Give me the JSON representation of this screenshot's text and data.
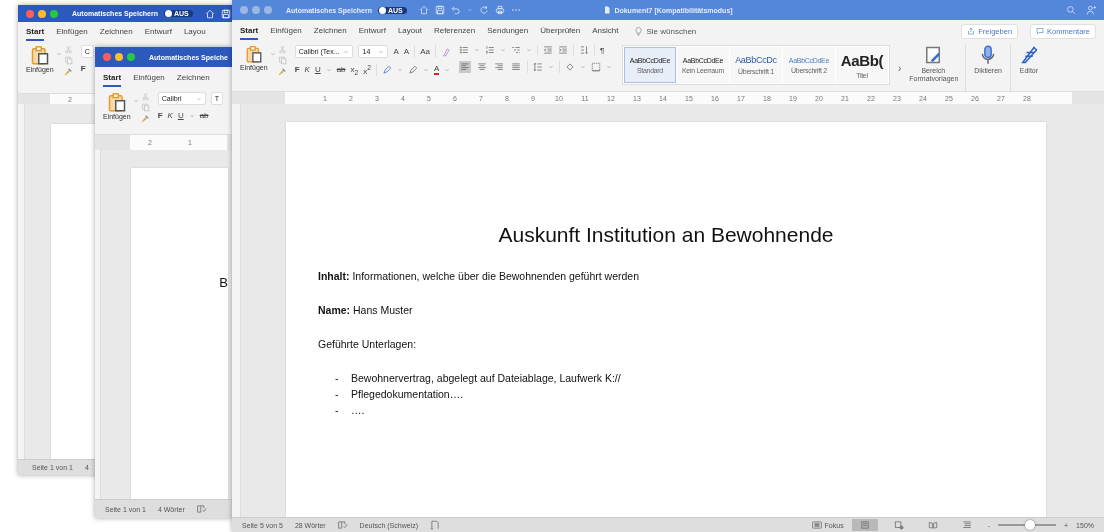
{
  "windows": [
    {
      "focused": true,
      "title_bar": {
        "autosave_label": "Automatisches Speichern",
        "autosave_toggle": {
          "label": "AUS",
          "on": false
        }
      },
      "tabs": [
        {
          "label": "Start",
          "selected": true
        },
        {
          "label": "Einfügen",
          "selected": false
        },
        {
          "label": "Zeichnen",
          "selected": false
        },
        {
          "label": "Entwurf",
          "selected": false
        },
        {
          "label": "Layou",
          "selected": false
        }
      ],
      "ribbon": {
        "paste_label": "Einfügen",
        "font_name": "C",
        "format_buttons": [
          "F"
        ]
      },
      "ruler_labels": [
        "2"
      ],
      "status_bar": {
        "page": "Seite 1 von 1",
        "word_count": "4"
      }
    },
    {
      "focused": true,
      "title_bar": {
        "autosave_label": "Automatisches Speiche"
      },
      "tabs": [
        {
          "label": "Start",
          "selected": true
        },
        {
          "label": "Einfügen",
          "selected": false
        },
        {
          "label": "Zeichnen",
          "selected": false
        }
      ],
      "ribbon": {
        "paste_label": "Einfügen",
        "font_name": "Calibri",
        "cut_control_text": "T",
        "format_buttons": [
          "F",
          "K",
          "U",
          "ab"
        ]
      },
      "ruler_labels": [
        "2",
        "1"
      ],
      "document": {
        "blocks": [
          {
            "kind": "heading",
            "text": "B"
          }
        ]
      },
      "status_bar": {
        "page": "Seite 1 von 1",
        "word_count": "4 Wörter"
      }
    },
    {
      "focused": false,
      "title_bar": {
        "autosave_label": "Automatisches Speichern",
        "autosave_toggle": {
          "label": "AUS",
          "on": false
        },
        "document_title": "Dokument7 [Kompatibilitätsmodus]"
      },
      "tabs": [
        {
          "label": "Start",
          "selected": true
        },
        {
          "label": "Einfügen",
          "selected": false
        },
        {
          "label": "Zeichnen",
          "selected": false
        },
        {
          "label": "Entwurf",
          "selected": false
        },
        {
          "label": "Layout",
          "selected": false
        },
        {
          "label": "Referenzen",
          "selected": false
        },
        {
          "label": "Sendungen",
          "selected": false
        },
        {
          "label": "Überprüfen",
          "selected": false
        },
        {
          "label": "Ansicht",
          "selected": false
        }
      ],
      "tell_me": "Sie wünschen",
      "share_button": "Freigeben",
      "comments_button": "Kommentare",
      "ribbon": {
        "paste_label": "Einfügen",
        "font_name": "Calibri (Tex...",
        "font_size": "14",
        "grow_font_button": "A",
        "shrink_font_button": "A",
        "case_button": "Aa",
        "pilcrow": "¶",
        "font_color_button": "A",
        "more_styles_arrow": "›",
        "format_buttons": [
          "F",
          "K",
          "U",
          "ab",
          "x$_{2}$",
          "x$^{2}$"
        ],
        "alignment": [
          {
            "selected": true
          },
          {
            "selected": false
          },
          {
            "selected": false
          },
          {
            "selected": false
          }
        ],
        "styles": [
          {
            "kind": "normal",
            "preview": "AaBbCcDdEe",
            "name": "Standard",
            "selected": true
          },
          {
            "kind": "normal",
            "preview": "AaBbCcDdEe",
            "name": "Kein Leerraum",
            "selected": false
          },
          {
            "kind": "heading1",
            "preview": "AaBbCcDc",
            "name": "Überschrift 1",
            "selected": false
          },
          {
            "kind": "heading2",
            "preview": "AaBbCcDdEe",
            "name": "Überschrift 2",
            "selected": false
          },
          {
            "kind": "title",
            "preview": "AaBb(",
            "name": "Titel",
            "selected": false
          }
        ],
        "styles_pane_label": "Bereich Formatvorlagen",
        "dictate_label": "Diktieren",
        "editor_label": "Editor"
      },
      "ruler_labels": [
        "1",
        "2",
        "3",
        "4",
        "5",
        "6",
        "7",
        "8",
        "9",
        "10",
        "11",
        "12",
        "13",
        "14",
        "15",
        "16",
        "17",
        "18",
        "19",
        "20",
        "21",
        "22",
        "23",
        "24",
        "25",
        "26",
        "27",
        "28"
      ],
      "document": {
        "blocks": [
          {
            "kind": "heading",
            "text": "Auskunft Institution an Bewohnende"
          },
          {
            "kind": "paragraph",
            "text": "**Inhalt:** Informationen, welche über die Bewohnenden geführt werden"
          },
          {
            "kind": "paragraph",
            "text": "**Name:** Hans Muster"
          },
          {
            "kind": "paragraph",
            "text": "Geführte Unterlagen:"
          },
          {
            "kind": "bullet",
            "marker": "-",
            "text": "Bewohnervertrag, abgelegt auf Dateiablage, Laufwerk K://"
          },
          {
            "kind": "bullet",
            "marker": "-",
            "text": "Pflegedokumentation…."
          },
          {
            "kind": "bullet",
            "marker": "-",
            "text": "…."
          }
        ]
      },
      "status_bar": {
        "page": "Seite 5 von 5",
        "word_count": "28 Wörter",
        "language": "Deutsch (Schweiz)",
        "focus_label": "Fokus",
        "views": [
          {
            "selected": true
          },
          {
            "selected": false
          },
          {
            "selected": false
          },
          {
            "selected": false
          }
        ],
        "zoom": {
          "out_button": "-",
          "in_button": "+",
          "level": 0.55,
          "reading": "150%"
        }
      }
    }
  ]
}
